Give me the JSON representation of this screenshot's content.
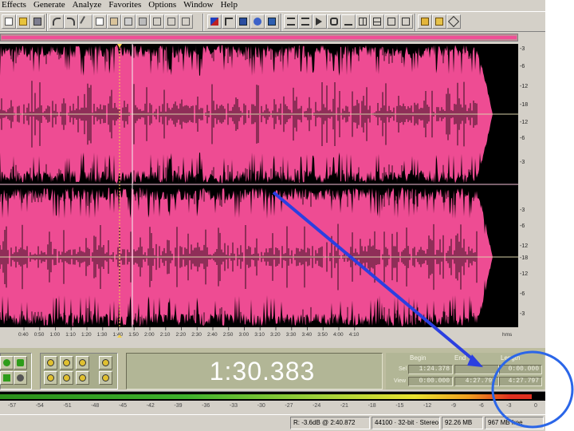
{
  "menubar": {
    "items": [
      "Effects",
      "Generate",
      "Analyze",
      "Favorites",
      "Options",
      "Window",
      "Help"
    ]
  },
  "toolbar": {
    "icons": [
      "new-file-icon",
      "open-file-icon",
      "save-icon",
      "undo-icon",
      "redo-icon",
      "cut-icon",
      "copy-icon",
      "paste-icon",
      "paste-mix-icon",
      "trim-icon",
      "waveform-view-icon",
      "spectral-view-icon",
      "cue-list-icon",
      "play-list-icon",
      "play-icon",
      "loop-icon",
      "tile-icon",
      "metronome-icon",
      "help-icon",
      "folder-icon",
      "script-icon",
      "info-icon"
    ]
  },
  "timeline": {
    "ticks": [
      "0:40",
      "0:50",
      "1:00",
      "1:10",
      "1:20",
      "1:30",
      "1:40",
      "1:50",
      "2:00",
      "2:10",
      "2:20",
      "2:30",
      "2:40",
      "2:50",
      "3:00",
      "3:10",
      "3:20",
      "3:30",
      "3:40",
      "3:50",
      "4:00",
      "4:10"
    ],
    "unit": "hms"
  },
  "db_scale": {
    "top": [
      "-3",
      "-6",
      "-12",
      "-18",
      "-12",
      "-6",
      "-3"
    ],
    "bottom": [
      "-3",
      "-6",
      "-12",
      "-18",
      "-12",
      "-6",
      "-3"
    ]
  },
  "time_display": "1:30.383",
  "selection": {
    "headers": {
      "begin": "Begin",
      "end": "End",
      "length": "Length"
    },
    "sel_label": "Sel",
    "view_label": "View",
    "sel_begin": "1:24.378",
    "sel_end": "",
    "sel_length": "0:00.000",
    "view_begin": "0:00.000",
    "view_end": "4:27.797",
    "view_length": "4:27.797"
  },
  "meter": {
    "level_fraction": 0.975,
    "scale": [
      "-57",
      "-54",
      "-51",
      "-48",
      "-45",
      "-42",
      "-39",
      "-36",
      "-33",
      "-30",
      "-27",
      "-24",
      "-21",
      "-18",
      "-15",
      "-12",
      "-9",
      "-6",
      "-3",
      "0"
    ]
  },
  "status": {
    "peak": "R: -3.6dB @  2:40.872",
    "format_rate": "44100",
    "format_bits": "32-bit",
    "format_channels": "Stereo",
    "file_size": "92.26 MB",
    "free_space": "967 MB free"
  },
  "colors": {
    "waveform": "#ee4c93",
    "annotation": "#2b3fe0"
  }
}
